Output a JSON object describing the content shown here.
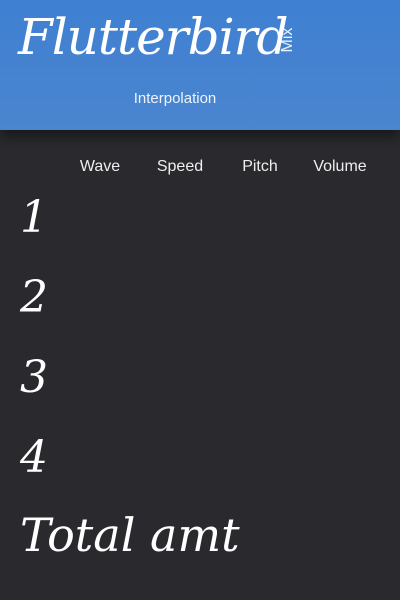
{
  "header": {
    "app_title": "Flutterbird",
    "mix_tab": "Mix",
    "mode_label": "Interpolation"
  },
  "columns": [
    "Wave",
    "Speed",
    "Pitch",
    "Volume"
  ],
  "rows": [
    "1",
    "2",
    "3",
    "4"
  ],
  "total_label": "Total amt",
  "colors": {
    "header_bg": "#4281d1",
    "body_bg": "#2a2a2e",
    "text": "#ffffff"
  }
}
